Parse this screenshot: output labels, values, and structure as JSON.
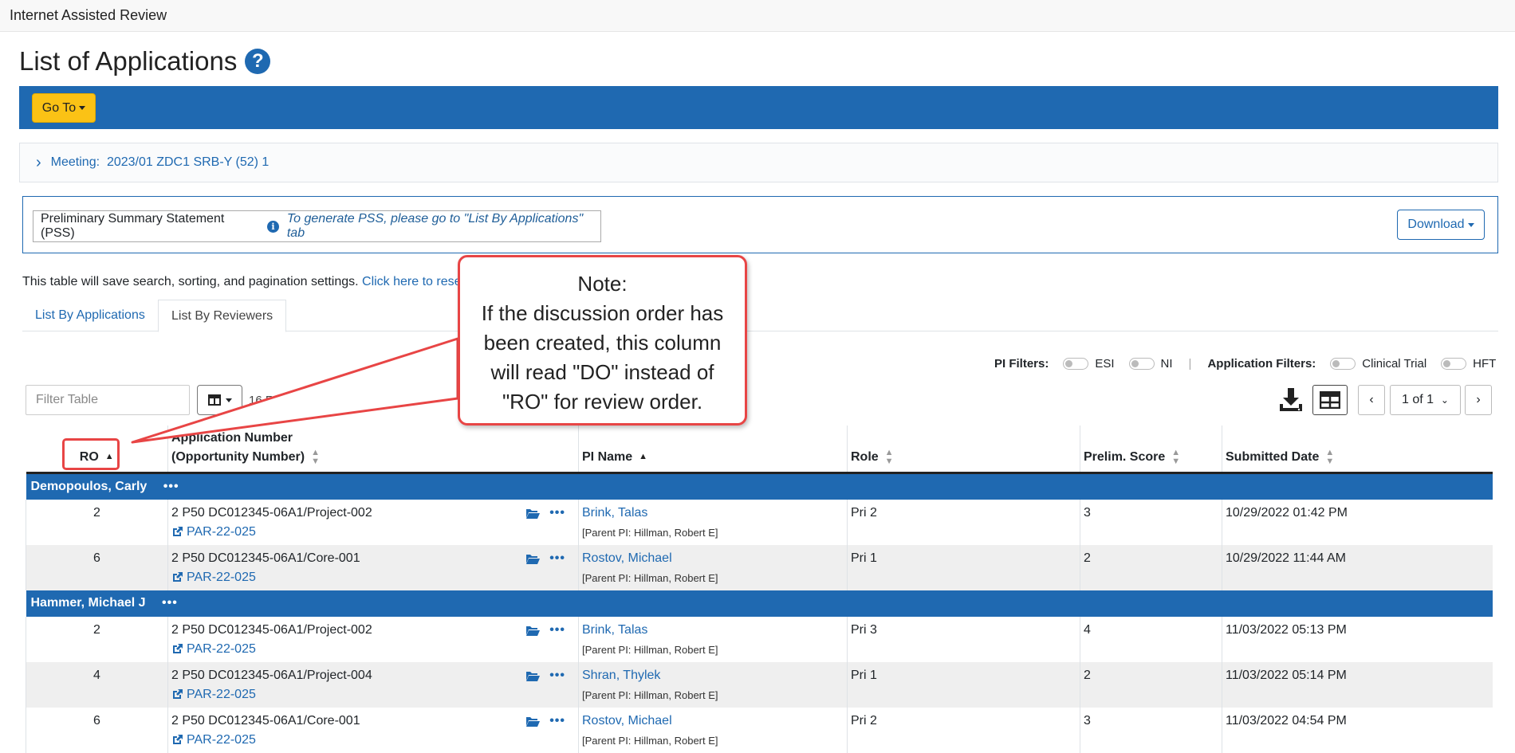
{
  "app": {
    "title": "Internet Assisted Review"
  },
  "page": {
    "title": "List of Applications",
    "help_icon": "question-circle-icon"
  },
  "goto": {
    "label": "Go To"
  },
  "meeting": {
    "label": "Meeting:",
    "value": "2023/01 ZDC1 SRB-Y (52) 1"
  },
  "pss": {
    "label": "Preliminary Summary Statement (PSS)",
    "hint": "To generate PSS, please go to \"List By Applications\" tab"
  },
  "download": {
    "label": "Download"
  },
  "save_note": {
    "text": "This table will save search, sorting, and pagination settings.",
    "link": "Click here to rese"
  },
  "tabs": [
    {
      "label": "List By Applications",
      "active": false
    },
    {
      "label": "List By Reviewers",
      "active": true
    }
  ],
  "filters": {
    "pi_label": "PI Filters:",
    "esi": "ESI",
    "ni": "NI",
    "app_label": "Application Filters:",
    "clinical": "Clinical Trial",
    "hft": "HFT"
  },
  "search": {
    "placeholder": "Filter Table"
  },
  "count_partial": "16 R",
  "pagination": {
    "page": "1 of 1"
  },
  "table": {
    "headers": {
      "ro": "RO",
      "app_line1": "Application Number",
      "app_line2": "(Opportunity Number)",
      "pi": "PI Name",
      "role": "Role",
      "score": "Prelim. Score",
      "date": "Submitted Date"
    },
    "groups": [
      {
        "reviewer": "Demopoulos, Carly",
        "rows": [
          {
            "ro": "2",
            "app": "2 P50 DC012345-06A1/Project-002",
            "foa": "PAR-22-025",
            "pi": "Brink, Talas",
            "parent": "[Parent PI: Hillman, Robert E]",
            "role": "Pri 2",
            "score": "3",
            "date": "10/29/2022 01:42 PM"
          },
          {
            "ro": "6",
            "app": "2 P50 DC012345-06A1/Core-001",
            "foa": "PAR-22-025",
            "pi": "Rostov, Michael",
            "parent": "[Parent PI: Hillman, Robert E]",
            "role": "Pri 1",
            "score": "2",
            "date": "10/29/2022 11:44 AM"
          }
        ]
      },
      {
        "reviewer": "Hammer, Michael J",
        "rows": [
          {
            "ro": "2",
            "app": "2 P50 DC012345-06A1/Project-002",
            "foa": "PAR-22-025",
            "pi": "Brink, Talas",
            "parent": "[Parent PI: Hillman, Robert E]",
            "role": "Pri 3",
            "score": "4",
            "date": "11/03/2022 05:13 PM"
          },
          {
            "ro": "4",
            "app": "2 P50 DC012345-06A1/Project-004",
            "foa": "PAR-22-025",
            "pi": "Shran, Thylek",
            "parent": "[Parent PI: Hillman, Robert E]",
            "role": "Pri 1",
            "score": "2",
            "date": "11/03/2022 05:14 PM"
          },
          {
            "ro": "6",
            "app": "2 P50 DC012345-06A1/Core-001",
            "foa": "PAR-22-025",
            "pi": "Rostov, Michael",
            "parent": "[Parent PI: Hillman, Robert E]",
            "role": "Pri 2",
            "score": "3",
            "date": "11/03/2022 04:54 PM"
          }
        ]
      }
    ]
  },
  "callout": {
    "lines": [
      "Note:",
      "If the discussion order has",
      "been created, this column",
      "will read \"DO\" instead of",
      "\"RO\" for review order."
    ],
    "color": "#e84545"
  },
  "colors": {
    "primary": "#1f69b1",
    "accent": "#fbc215"
  }
}
